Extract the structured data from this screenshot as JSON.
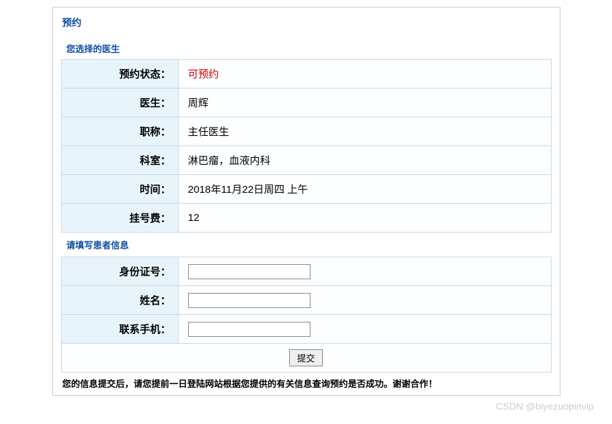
{
  "panel": {
    "title": "预约"
  },
  "doctor_section": {
    "title": "您选择的医生",
    "rows": {
      "status": {
        "label": "预约状态：",
        "value": "可预约"
      },
      "doctor": {
        "label": "医生：",
        "value": "周辉"
      },
      "title_rank": {
        "label": "职称：",
        "value": "主任医生"
      },
      "department": {
        "label": "科室：",
        "value": "淋巴瘤，血液内科"
      },
      "time": {
        "label": "时间：",
        "value": "2018年11月22日周四 上午"
      },
      "fee": {
        "label": "挂号费：",
        "value": "12"
      }
    }
  },
  "patient_section": {
    "title": "请填写患者信息",
    "fields": {
      "id_number": {
        "label": "身份证号：",
        "value": ""
      },
      "name": {
        "label": "姓名：",
        "value": ""
      },
      "phone": {
        "label": "联系手机：",
        "value": ""
      }
    },
    "submit_label": "提交"
  },
  "footer_note": "您的信息提交后，请您提前一日登陆网站根据您提供的有关信息查询预约是否成功。谢谢合作！",
  "watermark": "CSDN @biyezuopinvip"
}
